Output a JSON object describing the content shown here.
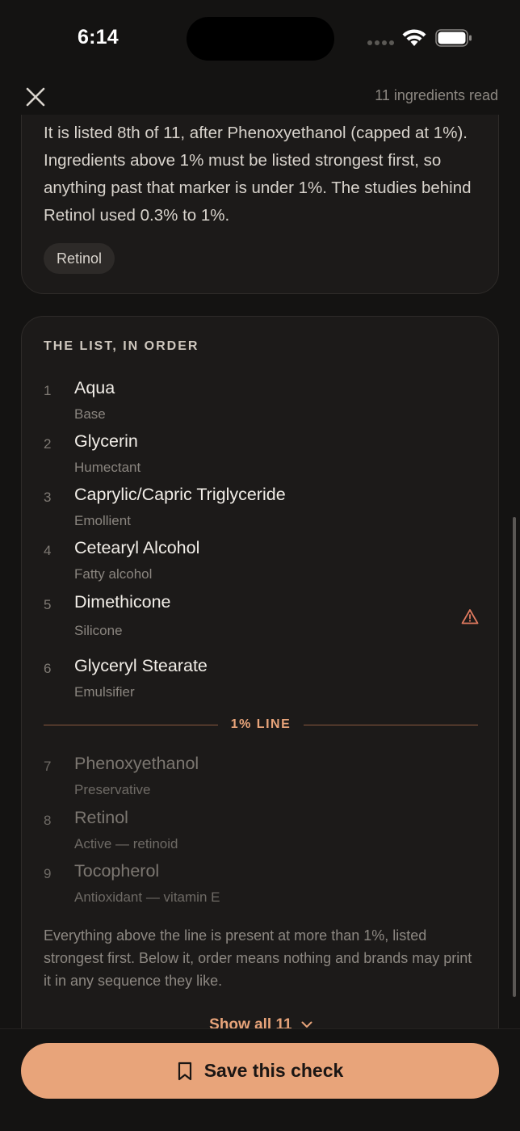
{
  "status_bar": {
    "time": "6:14"
  },
  "header": {
    "ingredients_read": "11 ingredients read"
  },
  "explanation": {
    "text": "It is listed 8th of 11, after Phenoxyethanol (capped at 1%). Ingredients above 1% must be listed strongest first, so anything past that marker is under 1%. The studies behind Retinol used 0.3% to 1%.",
    "chip": "Retinol"
  },
  "list": {
    "heading": "THE LIST, IN ORDER",
    "items": [
      {
        "num": "1",
        "name": "Aqua",
        "role": "Base"
      },
      {
        "num": "2",
        "name": "Glycerin",
        "role": "Humectant"
      },
      {
        "num": "3",
        "name": "Caprylic/Capric Triglyceride",
        "role": "Emollient"
      },
      {
        "num": "4",
        "name": "Cetearyl Alcohol",
        "role": "Fatty alcohol"
      },
      {
        "num": "5",
        "name": "Dimethicone",
        "role": "Silicone"
      },
      {
        "num": "6",
        "name": "Glyceryl Stearate",
        "role": "Emulsifier"
      },
      {
        "num": "7",
        "name": "Phenoxyethanol",
        "role": "Preservative"
      },
      {
        "num": "8",
        "name": "Retinol",
        "role": "Active — retinoid"
      },
      {
        "num": "9",
        "name": "Tocopherol",
        "role": "Antioxidant — vitamin E"
      }
    ],
    "one_percent_label": "1% LINE",
    "footnote": "Everything above the line is present at more than 1%, listed strongest first. Below it, order means nothing and brands may print it in any sequence they like.",
    "show_all": "Show all 11"
  },
  "save_button": {
    "label": "Save this check"
  },
  "colors": {
    "accent": "#e8a47a",
    "warning": "#e07a5f",
    "background": "#141312",
    "card": "#1c1a19"
  }
}
